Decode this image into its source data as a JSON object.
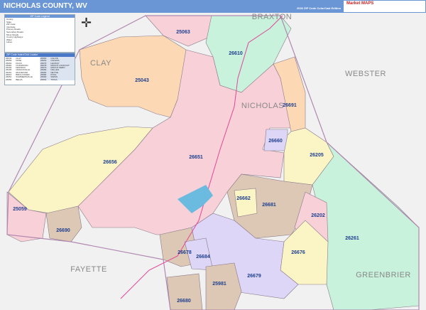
{
  "header": {
    "title": "NICHOLAS COUNTY, WV",
    "subtitle": "2026 ZIP Code ColorCast Edition",
    "logo_text": "Market MAPS"
  },
  "legend": {
    "title": "ZIP Code Legend",
    "items": [
      "County",
      "State",
      "ZIP Code",
      "Interstate",
      "Primary Roads",
      "Secondary Roads",
      "Minor Roads",
      "County Highways",
      "Water",
      "Lakes"
    ]
  },
  "index": {
    "title": "ZIP Code Index/Grid Locator",
    "left": [
      [
        "25043",
        "CLAY"
      ],
      [
        "25059",
        "DIXIE"
      ],
      [
        "25063",
        "DUCK"
      ],
      [
        "25981",
        "QUINWOOD"
      ],
      [
        "26202",
        "FENWICK"
      ],
      [
        "26205",
        "CRAIGSVILLE"
      ],
      [
        "26261",
        "RICHWOOD"
      ],
      [
        "26610",
        "BIRCH RIVER"
      ],
      [
        "26651",
        "SUMMERSVILLE"
      ],
      [
        "26656",
        "BELVA"
      ]
    ],
    "right": [
      [
        "26660",
        "CALVIN"
      ],
      [
        "26662",
        "CANVAS"
      ],
      [
        "26676",
        "LEIVASY"
      ],
      [
        "26678",
        "MOUNT LOOKOUT"
      ],
      [
        "26679",
        "MOUNT NEBO"
      ],
      [
        "26680",
        "NALLEN"
      ],
      [
        "26681",
        "NETTIE"
      ],
      [
        "26684",
        "POOL"
      ],
      [
        "26690",
        "SWISS"
      ],
      [
        "26691",
        "TIOGA"
      ]
    ]
  },
  "counties": [
    "CLAY",
    "BRAXTON",
    "WEBSTER",
    "NICHOLAS",
    "FAYETTE",
    "GREENBRIER"
  ],
  "zips": [
    "25063",
    "26610",
    "25043",
    "26691",
    "26660",
    "26205",
    "26651",
    "26656",
    "26662",
    "26681",
    "26202",
    "25059",
    "26690",
    "26261",
    "26678",
    "26684",
    "26676",
    "26679",
    "25981",
    "26680"
  ],
  "colors": {
    "header": "#6b96d6",
    "pink": "#f7d0d8",
    "orange": "#fcd9b4",
    "green": "#c8f2dc",
    "yellow": "#fbf5c6",
    "tan": "#dcc8b4",
    "purple": "#ddd6f6",
    "water": "#6bbbe0"
  }
}
